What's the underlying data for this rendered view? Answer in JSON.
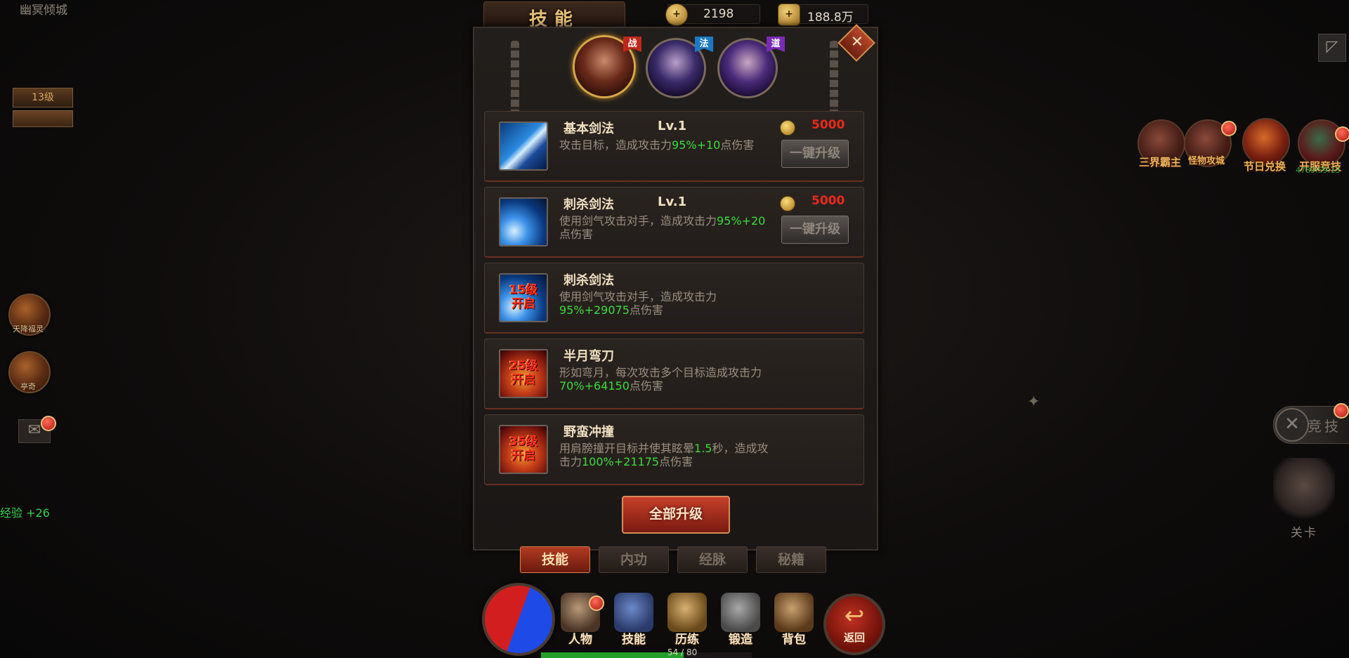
{
  "hud": {
    "zone_name": "幽冥倾城",
    "level_label": "13级",
    "left_buttons": [
      {
        "label": "天降福灵"
      },
      {
        "label": "亭奇"
      }
    ],
    "exp_gain": "经验 +26"
  },
  "right_hud": {
    "events": [
      {
        "label": "三界霸主"
      },
      {
        "label": "怪物攻城"
      },
      {
        "label": "节日兑换"
      },
      {
        "label": "开服竞技",
        "timer": "4789:59:13"
      }
    ],
    "pvp_label": "竞技",
    "stage_label": "关卡"
  },
  "top_bar": {
    "title": "技能",
    "currency1": "2198",
    "currency2": "188.8万"
  },
  "classes": [
    {
      "tag": "战",
      "tag_color": "#c0281a"
    },
    {
      "tag": "法",
      "tag_color": "#1a7ac8"
    },
    {
      "tag": "道",
      "tag_color": "#7a2ab8"
    }
  ],
  "skills": [
    {
      "name": "基本剑法",
      "level": "Lv.1",
      "desc_a": "攻击目标，造成攻击力",
      "desc_hl1": "95%+10",
      "desc_b": "点伤害",
      "desc_hl2": "",
      "desc_c": "",
      "cost": "5000",
      "button": "一键升级",
      "locked": ""
    },
    {
      "name": "刺杀剑法",
      "level": "Lv.1",
      "desc_a": "使用剑气攻击对手，造成攻击力",
      "desc_hl1": "95%+20",
      "desc_b": "点伤害",
      "desc_hl2": "",
      "desc_c": "",
      "cost": "5000",
      "button": "一键升级",
      "locked": ""
    },
    {
      "name": "刺杀剑法",
      "level": "",
      "desc_a": "使用剑气攻击对手，造成攻击力",
      "desc_hl1": "95%+29075",
      "desc_b": "点伤害",
      "desc_hl2": "",
      "desc_c": "",
      "cost": "",
      "button": "",
      "locked": "15级开启"
    },
    {
      "name": "半月弯刀",
      "level": "",
      "desc_a": "形如弯月，每次攻击多个目标造成攻击力",
      "desc_hl1": "70%+64150",
      "desc_b": "点伤害",
      "desc_hl2": "",
      "desc_c": "",
      "cost": "",
      "button": "",
      "locked": "25级开启"
    },
    {
      "name": "野蛮冲撞",
      "level": "",
      "desc_a": "用肩膀撞开目标并使其眩晕",
      "desc_hl1": "1.5",
      "desc_b": "秒，造成攻击力",
      "desc_hl2": "100%+21175",
      "desc_c": "点伤害",
      "cost": "",
      "button": "",
      "locked": "35级开启"
    }
  ],
  "upgrade_all": "全部升级",
  "tabs": [
    "技能",
    "内功",
    "经脉",
    "秘籍"
  ],
  "bottom_menu": [
    "人物",
    "技能",
    "历练",
    "锻造",
    "背包"
  ],
  "back_label": "返回",
  "xp_text": "54 / 80",
  "xp_fraction": 0.675
}
